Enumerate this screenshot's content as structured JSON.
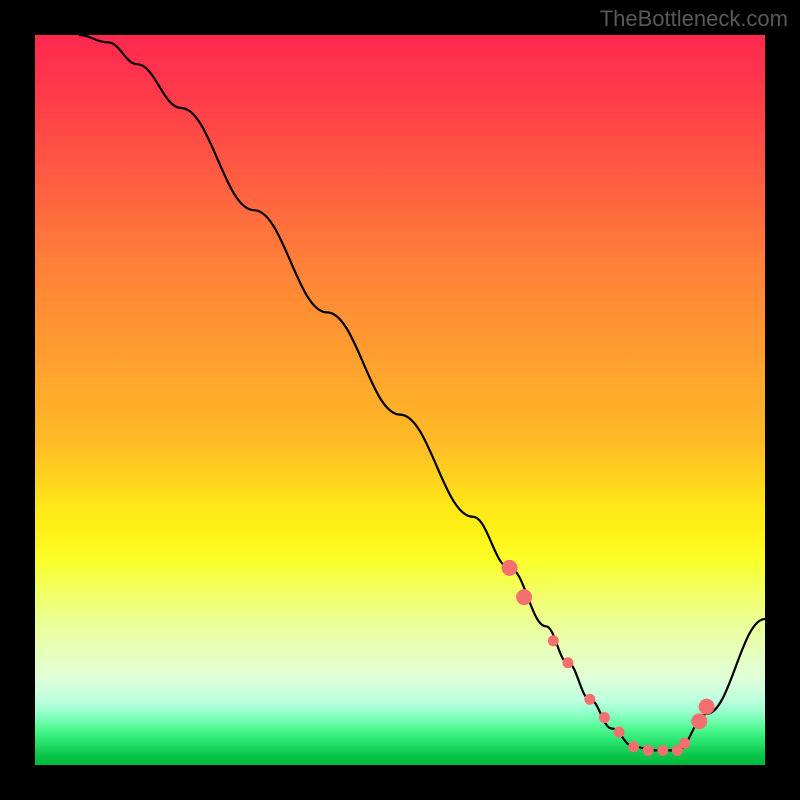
{
  "watermark": "TheBottleneck.com",
  "chart_data": {
    "type": "line",
    "title": "",
    "xlabel": "",
    "ylabel": "",
    "xlim": [
      0,
      100
    ],
    "ylim": [
      0,
      100
    ],
    "series": [
      {
        "name": "curve",
        "x": [
          6,
          10,
          14,
          20,
          30,
          40,
          50,
          60,
          65,
          70,
          73,
          76,
          79,
          82,
          85,
          88,
          92,
          100
        ],
        "values": [
          100,
          99,
          96,
          90,
          76,
          62,
          48,
          34,
          27,
          19,
          14,
          9,
          5,
          2.5,
          2,
          2,
          7,
          20
        ]
      }
    ],
    "highlight_points": {
      "color": "#f47070",
      "size_mid": 5.5,
      "size_ends": 8,
      "x": [
        65,
        67,
        71,
        73,
        76,
        78,
        80,
        82,
        84,
        86,
        88,
        89,
        91,
        92
      ],
      "y": [
        27,
        23,
        17,
        14,
        9,
        6.5,
        4.5,
        2.5,
        2,
        2,
        2,
        3,
        6,
        8
      ]
    }
  }
}
